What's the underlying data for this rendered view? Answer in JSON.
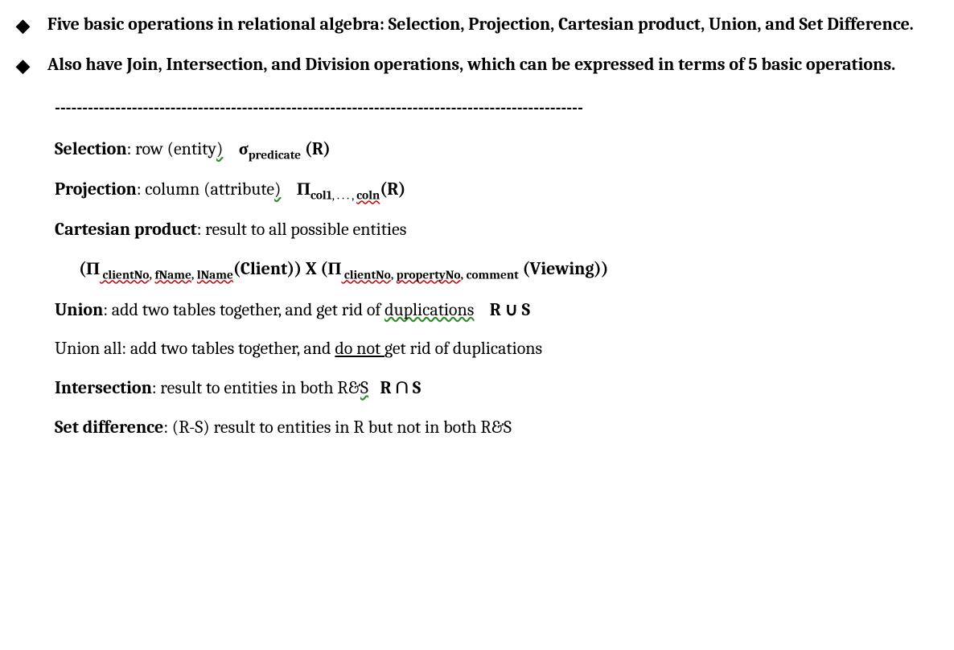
{
  "bullets": [
    "Five basic operations in relational algebra: Selection, Projection, Cartesian product, Union, and Set Difference.",
    "Also have Join, Intersection, and Division operations, which can be expressed in terms of 5 basic operations."
  ],
  "divider": "------------------------------------------------------------------------------------------------",
  "selection": {
    "label": "Selection",
    "desc": ": row (entity",
    "closeParen": ")",
    "sigma": "σ",
    "subscript": "predicate",
    "rel": " (R)"
  },
  "projection": {
    "label": "Projection",
    "desc": ": column (attribute",
    "closeParen": ")",
    "pi": "Π",
    "sub1": "col1",
    "subMid": ", . . . , ",
    "sub2": "coln",
    "rel": "(R)"
  },
  "cartesian": {
    "label": "Cartesian product",
    "desc": ": result to all possible entities"
  },
  "cartExample": {
    "open": "(Π",
    "s1": " clientNo",
    "s2": "fName",
    "s3": "lName",
    "mid": "(Client)) X (Π",
    "s4": " clientNo",
    "s5": "propertyNo",
    "s6": "comment",
    "end": " (Viewing))"
  },
  "union": {
    "label": "Union",
    "desc": ": add two tables together, and get rid of ",
    "dup": "duplications",
    "formula": "R ∪ S"
  },
  "unionAll": {
    "text1": "Union all: add two tables together, and ",
    "underlined": "do not ",
    "text2": "get rid of duplications"
  },
  "intersection": {
    "label": "Intersection",
    "desc": ": result to entities in both R&",
    "s": "S",
    "gap": "    ",
    "formula": "R ∩ S"
  },
  "setdiff": {
    "label": "Set difference",
    "desc": ": (R-S) result to entities in R but not in both R&S"
  },
  "comma": ", "
}
